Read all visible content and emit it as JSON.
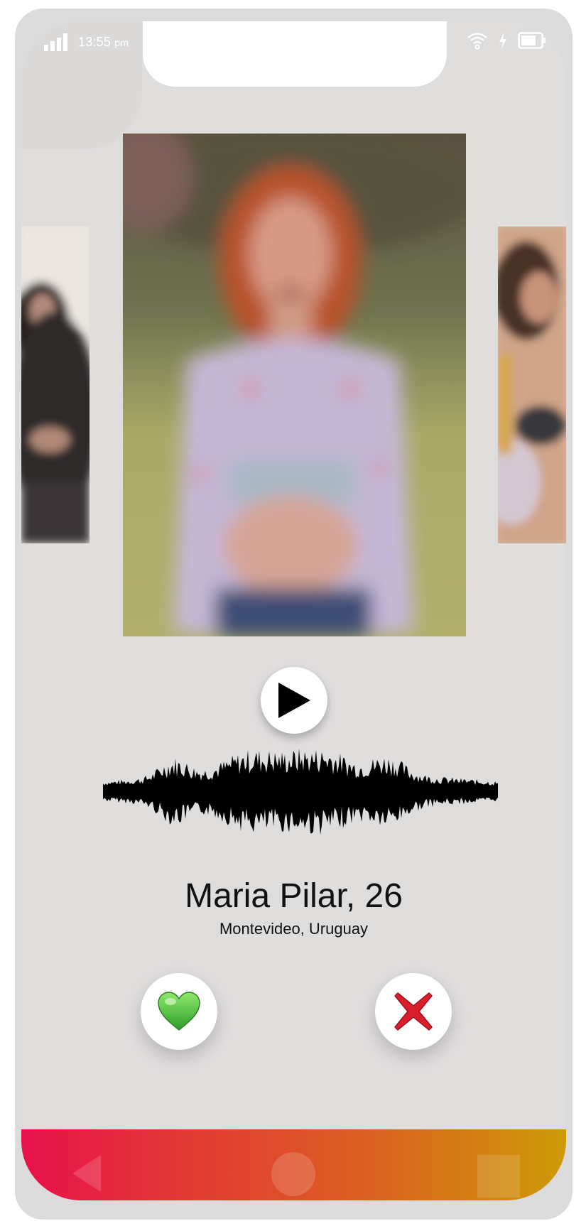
{
  "status_bar": {
    "time": "13:55",
    "period": "pm"
  },
  "profile": {
    "name_age": "Maria Pilar, 26",
    "location": "Montevideo, Uruguay"
  },
  "icons": {
    "signal": "signal-icon",
    "wifi": "wifi-icon",
    "charging": "charging-icon",
    "battery": "battery-icon",
    "play": "play-icon",
    "like": "green-heart-icon",
    "dislike": "red-x-icon",
    "nav_back": "back-triangle-icon",
    "nav_home": "home-circle-icon",
    "nav_recent": "recent-square-icon"
  },
  "colors": {
    "phone_bg": "#dfdcdc",
    "nav_gradient": [
      "#e8114b",
      "#e23a34",
      "#dd5b23",
      "#cd9a06"
    ],
    "like": "#5fcf4a",
    "dislike": "#d91e2e"
  }
}
